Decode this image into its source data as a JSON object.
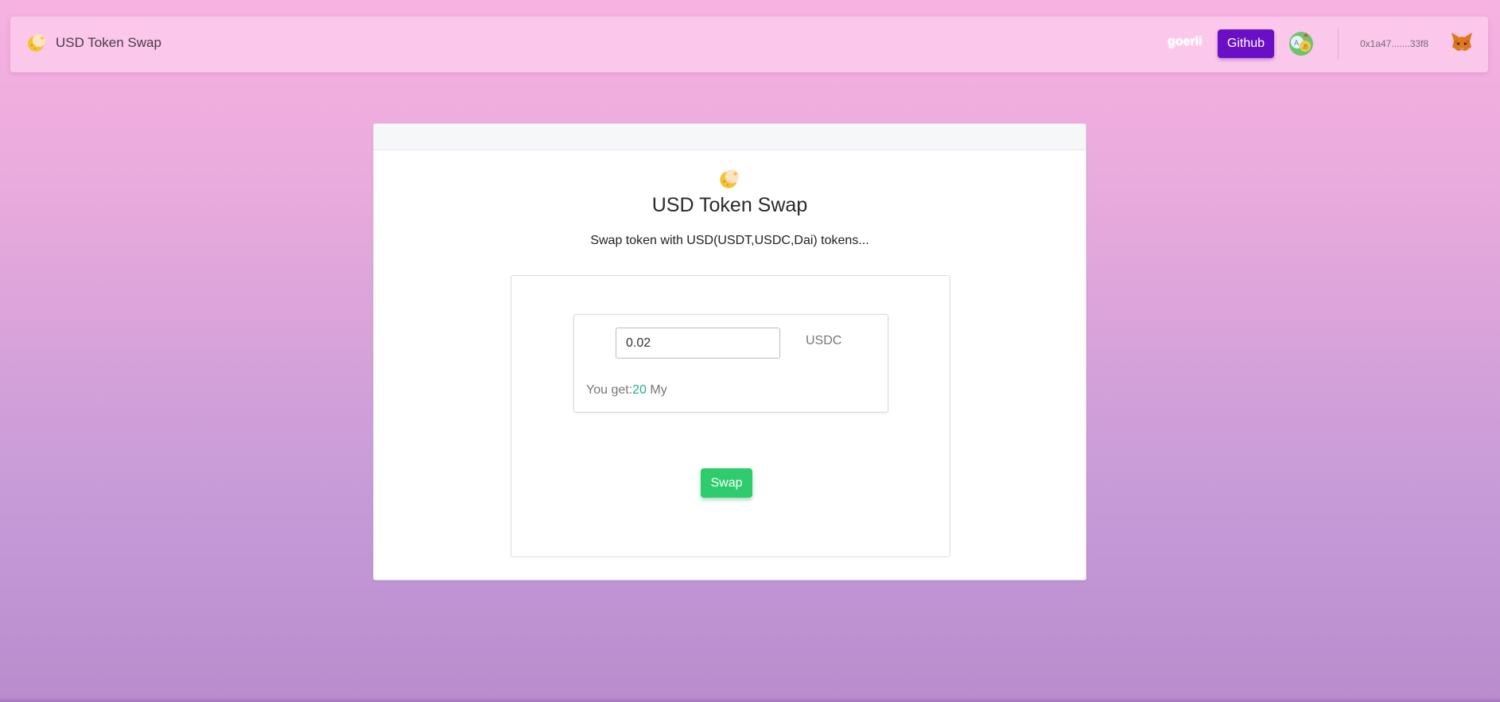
{
  "navbar": {
    "brand_title": "USD Token Swap",
    "network": "goerli",
    "github_label": "Github",
    "wallet_address": "0x1a47.......33f8",
    "icons": {
      "logo": "moon-logo-icon",
      "translate": "translate-icon",
      "wallet": "metamask-fox-icon"
    }
  },
  "main": {
    "title": "USD Token Swap",
    "subtitle": "Swap token with USD(USDT,USDC,Dai) tokens...",
    "swap": {
      "amount_value": "0.02",
      "token": "USDC",
      "you_get_label": "You get:",
      "you_get_amount": "20",
      "you_get_unit": "My",
      "swap_label": "Swap"
    }
  },
  "colors": {
    "accent_purple": "#6a0fc6",
    "swap_green": "#2fcc6e",
    "amount_green": "#1fb57a"
  }
}
